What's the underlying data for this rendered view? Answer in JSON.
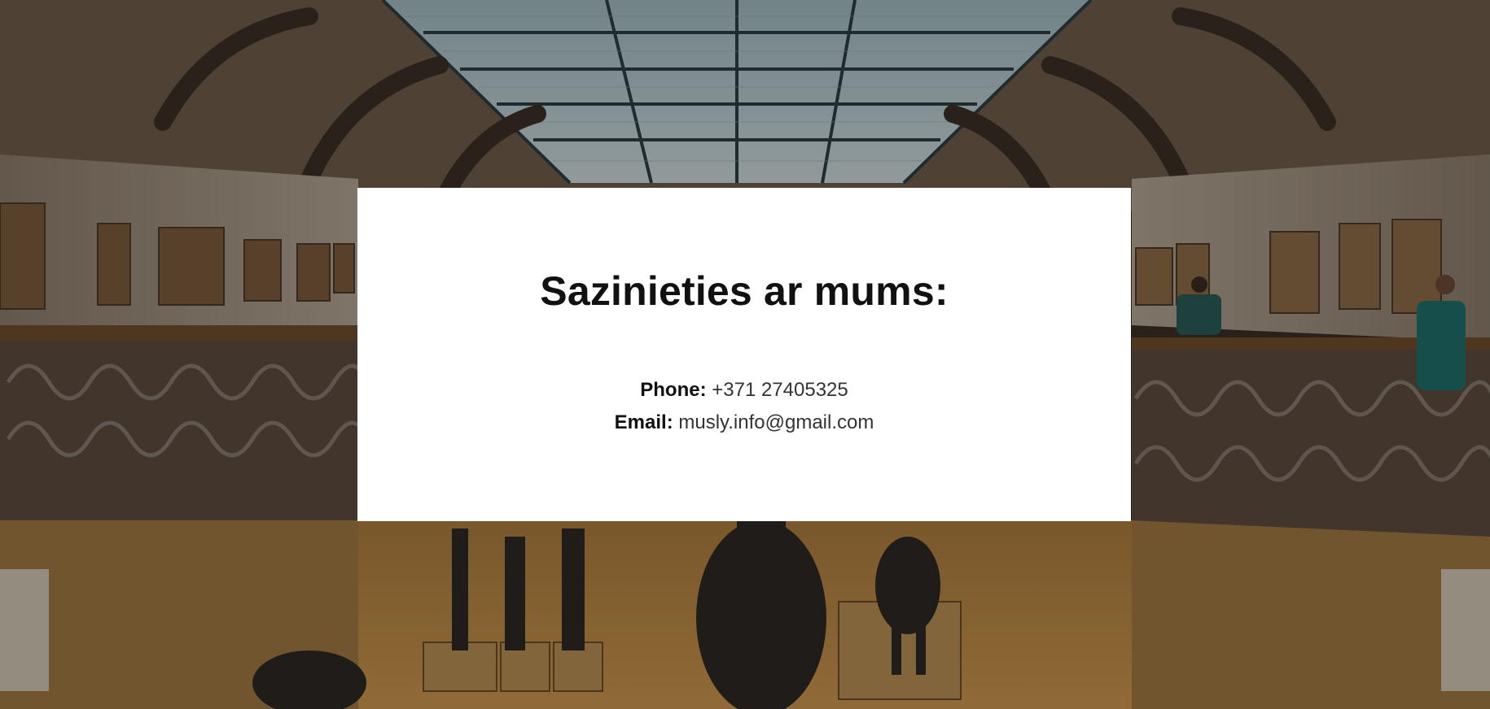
{
  "contact": {
    "title": "Sazinieties ar mums:",
    "phone_label": "Phone:",
    "phone_value": "+371 27405325",
    "email_label": "Email:",
    "email_value": "musly.info@gmail.com"
  },
  "background": {
    "description_icon": "museum-hall-photo"
  },
  "colors": {
    "card_background": "#ffffff",
    "text": "#111111"
  }
}
